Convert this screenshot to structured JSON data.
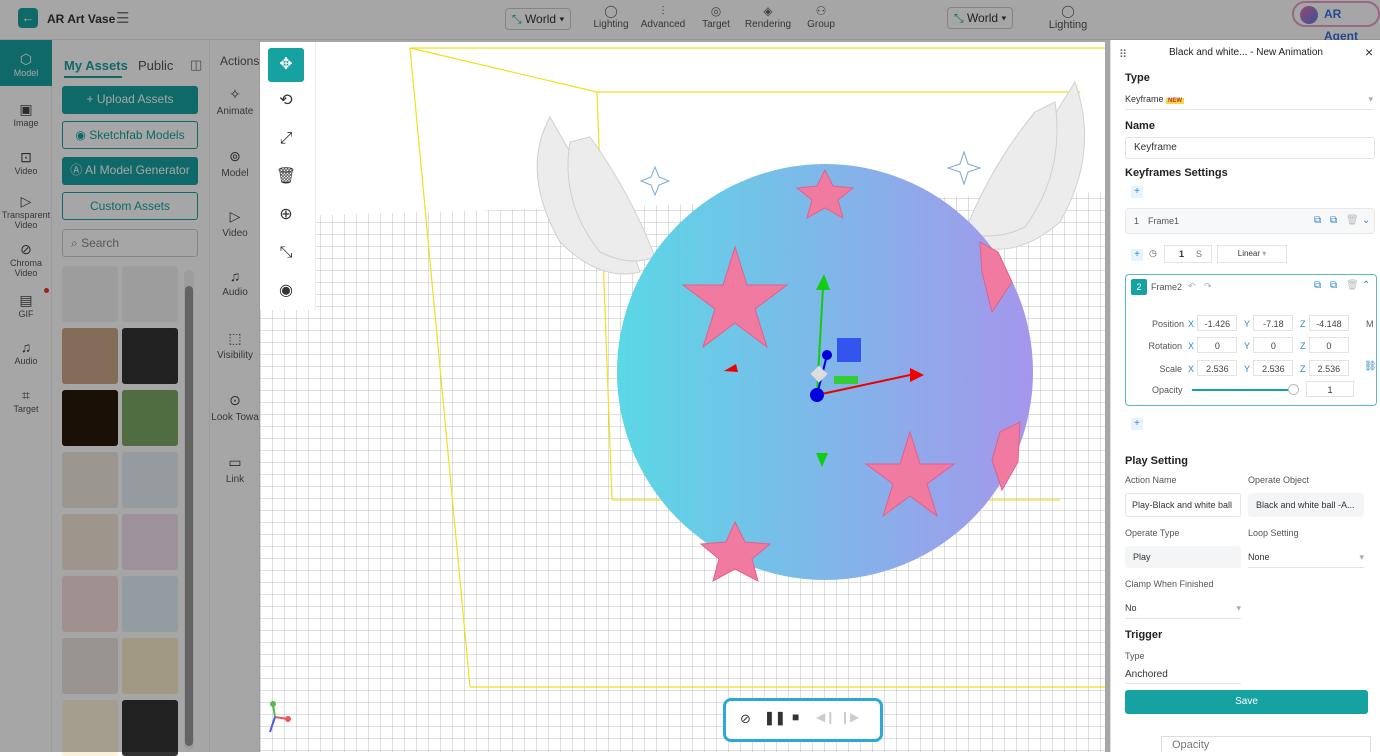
{
  "app": {
    "title": "AR Art Vase",
    "agent": "AR Agent"
  },
  "toolbar": {
    "world": "World",
    "items": [
      {
        "label": "Lighting",
        "icon": "bulb-icon"
      },
      {
        "label": "Advanced",
        "icon": "sliders-icon"
      },
      {
        "label": "Target",
        "icon": "target-icon"
      },
      {
        "label": "Rendering",
        "icon": "render-icon"
      },
      {
        "label": "Group",
        "icon": "group-icon"
      }
    ],
    "world2": "World",
    "lighting2": "Lighting"
  },
  "rail": [
    {
      "label": "Model",
      "icon": "cube-icon"
    },
    {
      "label": "Image",
      "icon": "image-icon"
    },
    {
      "label": "Video",
      "icon": "video-icon"
    },
    {
      "label": "Transparent Video",
      "icon": "transparent-video-icon"
    },
    {
      "label": "Chroma Video",
      "icon": "chroma-icon"
    },
    {
      "label": "GIF",
      "icon": "gif-icon"
    },
    {
      "label": "Audio",
      "icon": "music-icon"
    },
    {
      "label": "Target",
      "icon": "target-icon"
    }
  ],
  "assets": {
    "tab_mine": "My Assets",
    "tab_public": "Public",
    "upload": "Upload Assets",
    "sketchfab": "Sketchfab Models",
    "ai": "AI Model Generator",
    "custom": "Custom Assets",
    "search_placeholder": "Search"
  },
  "actions": {
    "title": "Actions",
    "items": [
      "Animate",
      "Model",
      "Video",
      "Audio",
      "Visibility",
      "Look Towa",
      "Link"
    ]
  },
  "panel": {
    "title": "Black and white... - New Animation",
    "type_label": "Type",
    "type_value": "Keyframe",
    "type_badge": "NEW",
    "name_label": "Name",
    "name_value": "Keyframe",
    "kf_label": "Keyframes Settings",
    "frame1": {
      "index": "1",
      "name": "Frame1"
    },
    "duration": "1",
    "duration_unit": "S",
    "easing": "Linear",
    "frame2": {
      "index": "2",
      "name": "Frame2",
      "position": {
        "label": "Position",
        "x": "-1.426",
        "y": "-7.18",
        "z": "-4.148",
        "unit": "M"
      },
      "rotation": {
        "label": "Rotation",
        "x": "0",
        "y": "0",
        "z": "0"
      },
      "scale": {
        "label": "Scale",
        "x": "2.536",
        "y": "2.536",
        "z": "2.536"
      },
      "opacity": {
        "label": "Opacity",
        "value": "1"
      }
    },
    "axes": {
      "x": "X",
      "y": "Y",
      "z": "Z"
    },
    "play_setting": "Play Setting",
    "action_name_label": "Action Name",
    "action_name_value": "Play-Black and white ball",
    "operate_object_label": "Operate Object",
    "operate_object_value": "Black and white ball -A...",
    "operate_type_label": "Operate Type",
    "operate_type_value": "Play",
    "loop_label": "Loop Setting",
    "loop_value": "None",
    "clamp_label": "Clamp When Finished",
    "clamp_value": "No",
    "trigger": "Trigger",
    "trigger_type_label": "Type",
    "trigger_type_value": "Anchored",
    "save": "Save"
  },
  "behind": {
    "opacity": "Opacity"
  }
}
